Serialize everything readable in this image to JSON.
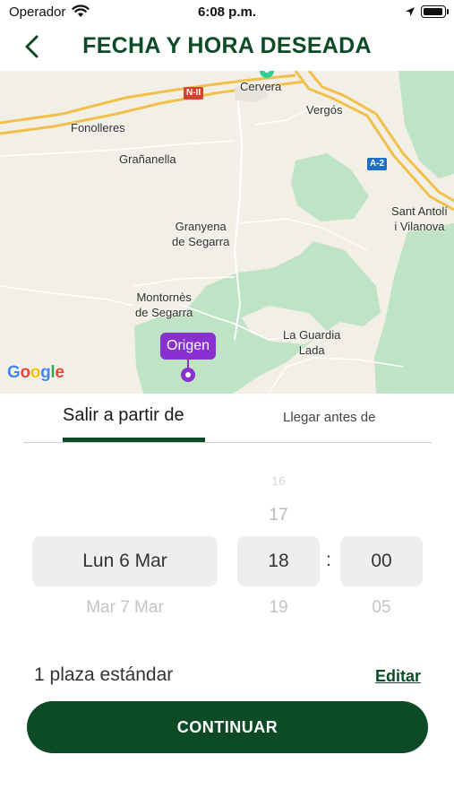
{
  "status_bar": {
    "carrier": "Operador",
    "time": "6:08 p.m."
  },
  "header": {
    "title": "FECHA Y HORA DESEADA",
    "back_icon": "chevron-left-icon"
  },
  "map": {
    "places": {
      "cervera": "Cervera",
      "fonolleres": "Fonolleres",
      "vergos": "Vergós",
      "granyanella": "Grañanella",
      "granyena_1": "Granyena",
      "granyena_2": "de Segarra",
      "sant_antoli_1": "Sant Antolí",
      "sant_antoli_2": "i Vilanova",
      "montornes_1": "Montornès",
      "montornes_2": "de Segarra",
      "guardia_1": "La Guardia",
      "guardia_2": "Lada"
    },
    "roads": {
      "n2": "N-II",
      "a2": "A-2"
    },
    "origin_label": "Origen",
    "attribution": "Google",
    "colors": {
      "land": "#f2efe6",
      "park": "#bfe3c5",
      "highway": "#f2c04a",
      "origin": "#8a2fd0"
    }
  },
  "tabs": {
    "active": "Salir a partir de",
    "inactive": "Llegar antes de"
  },
  "picker": {
    "date_selected": "Lun 6 Mar",
    "date_next": "Mar 7 Mar",
    "hour_prev_2": "16",
    "hour_prev": "17",
    "hour_selected": "18",
    "hour_next": "19",
    "separator": ":",
    "minute_selected": "00",
    "minute_next": "05"
  },
  "booking": {
    "seat_label": "1 plaza estándar",
    "edit_label": "Editar",
    "continue_label": "CONTINUAR"
  },
  "colors": {
    "brand": "#0d4a26"
  }
}
